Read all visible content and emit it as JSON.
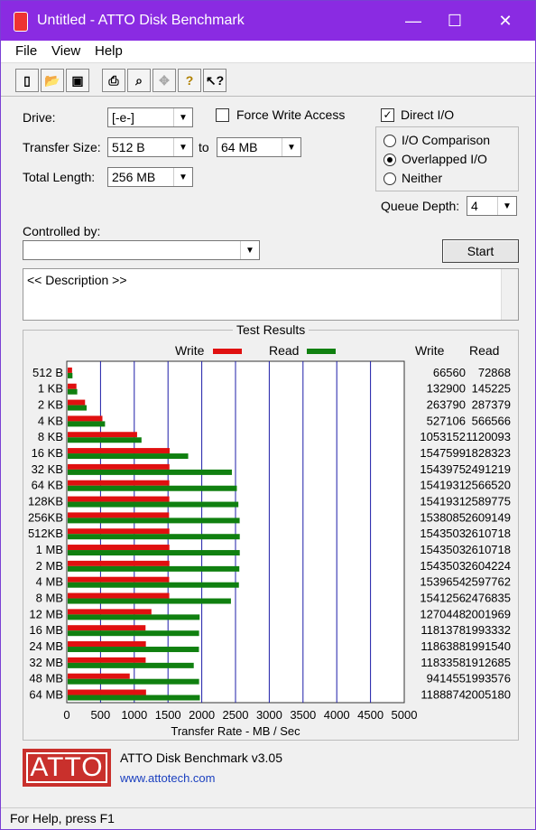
{
  "window": {
    "title": "Untitled - ATTO Disk Benchmark",
    "minimize": "—",
    "maximize": "☐",
    "close": "✕"
  },
  "menu": [
    "File",
    "View",
    "Help"
  ],
  "form": {
    "drive_label": "Drive:",
    "drive_value": "[-e-]",
    "force_write_label": "Force Write Access",
    "direct_io_label": "Direct I/O",
    "transfer_size_label": "Transfer Size:",
    "transfer_from": "512 B",
    "to_label": "to",
    "transfer_to": "64 MB",
    "total_length_label": "Total Length:",
    "total_length_value": "256 MB",
    "io_comparison": "I/O Comparison",
    "overlapped_io": "Overlapped I/O",
    "neither": "Neither",
    "queue_depth_label": "Queue Depth:",
    "queue_depth_value": "4",
    "controlled_by_label": "Controlled by:",
    "controlled_by_value": "",
    "start_label": "Start",
    "description": "<< Description >>"
  },
  "results": {
    "title": "Test Results",
    "legend_write": "Write",
    "legend_read": "Read",
    "col_write": "Write",
    "col_read": "Read",
    "write_color": "#e01010",
    "read_color": "#108010",
    "xlabel": "Transfer Rate - MB / Sec"
  },
  "chart_data": {
    "type": "bar",
    "categories": [
      "512 B",
      "1 KB",
      "2 KB",
      "4 KB",
      "8 KB",
      "16 KB",
      "32 KB",
      "64 KB",
      "128KB",
      "256KB",
      "512KB",
      "1 MB",
      "2 MB",
      "4 MB",
      "8 MB",
      "12 MB",
      "16 MB",
      "24 MB",
      "32 MB",
      "48 MB",
      "64 MB"
    ],
    "series": [
      {
        "name": "Write",
        "values": [
          66560,
          132900,
          263790,
          527106,
          1053152,
          1547599,
          1543975,
          1541931,
          1541931,
          1538085,
          1543503,
          1543503,
          1543503,
          1539654,
          1541256,
          1270448,
          1181378,
          1186388,
          1183358,
          941455,
          1188874
        ]
      },
      {
        "name": "Read",
        "values": [
          72868,
          145225,
          287379,
          566566,
          1120093,
          1828323,
          2491219,
          2566520,
          2589775,
          2609149,
          2610718,
          2610718,
          2604224,
          2597762,
          2476835,
          2001969,
          1993332,
          1991540,
          1912685,
          1993576,
          2005180
        ]
      }
    ],
    "ticks": [
      "0",
      "500",
      "1000",
      "1500",
      "2000",
      "2500",
      "3000",
      "3500",
      "4000",
      "4500",
      "5000"
    ],
    "xlim": [
      0,
      5000
    ],
    "xlabel": "Transfer Rate - MB / Sec",
    "ylabel": ""
  },
  "footer": {
    "logo": "ATTO",
    "version": "ATTO Disk Benchmark v3.05",
    "url": "www.attotech.com"
  },
  "status": "For Help, press F1"
}
